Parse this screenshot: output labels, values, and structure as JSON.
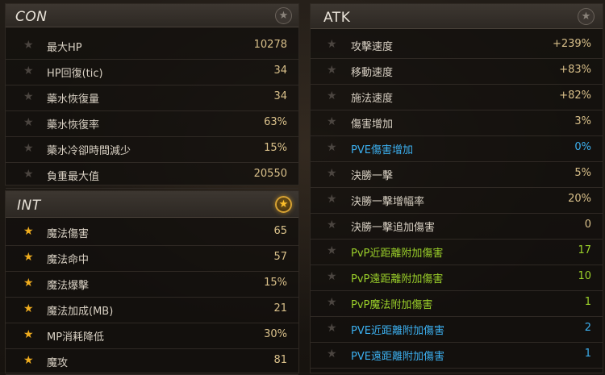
{
  "con": {
    "title": "CON",
    "starred": false,
    "rows": [
      {
        "label": "最大HP",
        "value": "10278",
        "color": ""
      },
      {
        "label": "HP回復(tic)",
        "value": "34",
        "color": ""
      },
      {
        "label": "藥水恢復量",
        "value": "34",
        "color": ""
      },
      {
        "label": "藥水恢復率",
        "value": "63%",
        "color": ""
      },
      {
        "label": "藥水冷卻時間減少",
        "value": "15%",
        "color": ""
      },
      {
        "label": "負重最大值",
        "value": "20550",
        "color": ""
      }
    ]
  },
  "int": {
    "title": "INT",
    "starred": true,
    "rows": [
      {
        "label": "魔法傷害",
        "value": "65",
        "color": ""
      },
      {
        "label": "魔法命中",
        "value": "57",
        "color": ""
      },
      {
        "label": "魔法爆擊",
        "value": "15%",
        "color": ""
      },
      {
        "label": "魔法加成(MB)",
        "value": "21",
        "color": ""
      },
      {
        "label": "MP消耗降低",
        "value": "30%",
        "color": ""
      },
      {
        "label": "魔攻",
        "value": "81",
        "color": ""
      }
    ]
  },
  "atk": {
    "title": "ATK",
    "starred": false,
    "rows": [
      {
        "label": "攻擊速度",
        "value": "+239%",
        "color": ""
      },
      {
        "label": "移動速度",
        "value": "+83%",
        "color": ""
      },
      {
        "label": "施法速度",
        "value": "+82%",
        "color": ""
      },
      {
        "label": "傷害增加",
        "value": "3%",
        "color": ""
      },
      {
        "label": "PVE傷害增加",
        "value": "0%",
        "color": "blue"
      },
      {
        "label": "決勝一擊",
        "value": "5%",
        "color": ""
      },
      {
        "label": "決勝一擊增幅率",
        "value": "20%",
        "color": ""
      },
      {
        "label": "決勝一擊追加傷害",
        "value": "0",
        "color": ""
      },
      {
        "label": "PvP近距離附加傷害",
        "value": "17",
        "color": "green"
      },
      {
        "label": "PvP遠距離附加傷害",
        "value": "10",
        "color": "green"
      },
      {
        "label": "PvP魔法附加傷害",
        "value": "1",
        "color": "green"
      },
      {
        "label": "PVE近距離附加傷害",
        "value": "2",
        "color": "blue"
      },
      {
        "label": "PVE遠距離附加傷害",
        "value": "1",
        "color": "blue"
      }
    ]
  },
  "icons": {
    "row_star": "star-icon",
    "header_star": "favorite-star-icon"
  },
  "colors": {
    "accent_gold": "#f0ad1e",
    "value_text": "#d9c08a",
    "pve_blue": "#3cb0f0",
    "pvp_green": "#9bd02a"
  }
}
